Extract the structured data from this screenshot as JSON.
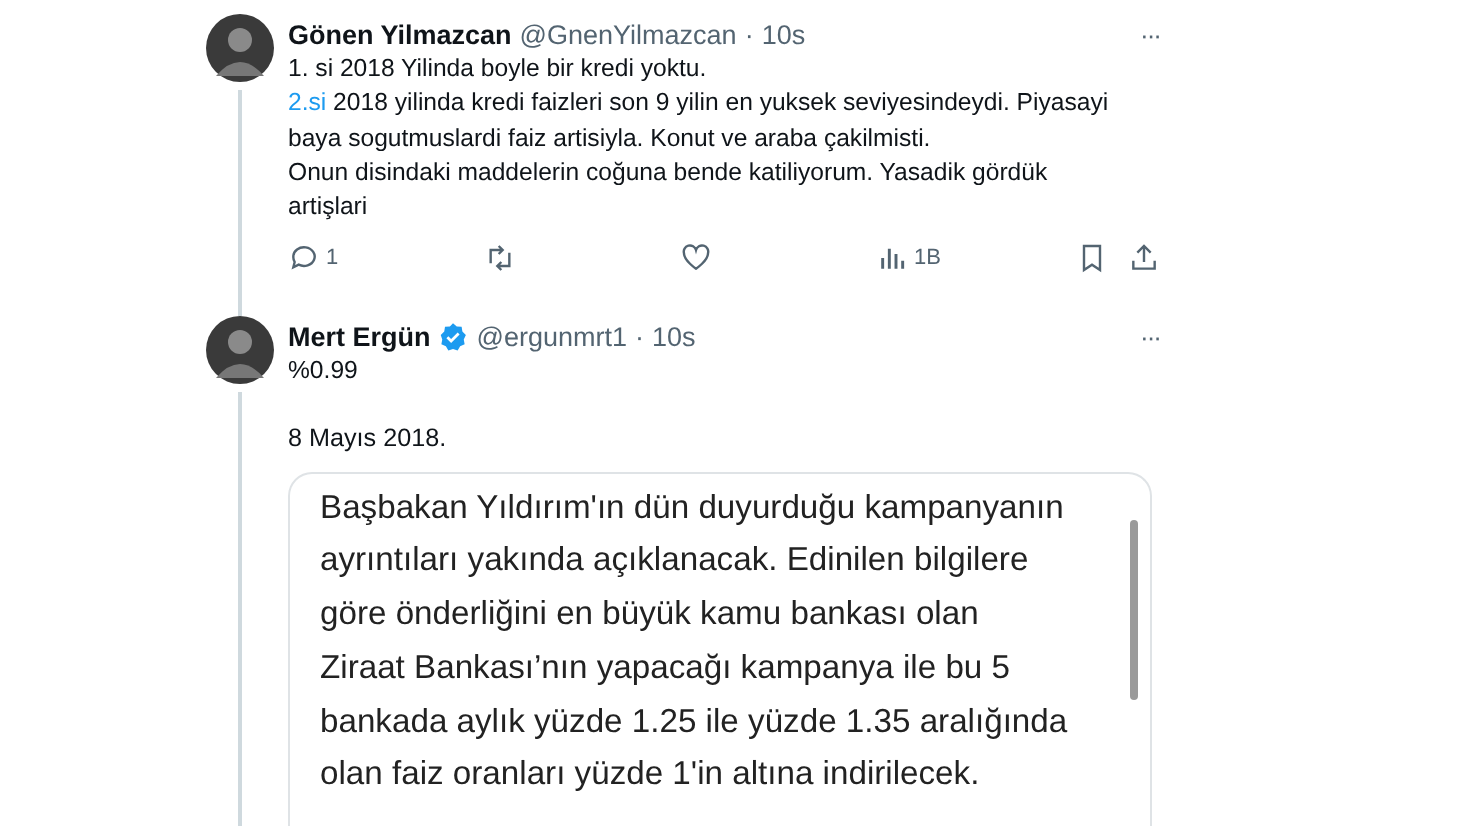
{
  "tweets": [
    {
      "name": "Gönen Yilmazcan",
      "verified": false,
      "handle": "@GnenYilmazcan",
      "separator": "·",
      "time": "10s",
      "more": "···",
      "lines": [
        {
          "parts": [
            {
              "text": "1. si 2018 Yilinda boyle bir kredi yoktu.",
              "link": false
            }
          ]
        },
        {
          "parts": [
            {
              "text": "2.si",
              "link": true
            },
            {
              "text": " 2018 yilinda kredi faizleri son 9 yilin en yuksek seviyesindeydi. Piyasayi baya sogutmuslardi faiz artisiyla. Konut ve araba çakilmisti.",
              "link": false
            }
          ]
        },
        {
          "parts": [
            {
              "text": "Onun disindaki maddelerin coğuna bende katiliyorum. Yasadik gördük artişlari",
              "link": false
            }
          ]
        }
      ],
      "actions": {
        "replies": "1",
        "views": "1B"
      }
    },
    {
      "name": "Mert Ergün",
      "verified": true,
      "handle": "@ergunmrt1",
      "separator": "·",
      "time": "10s",
      "more": "···",
      "lines": [
        {
          "parts": [
            {
              "text": "%0.99",
              "link": false
            }
          ]
        }
      ],
      "date": "8 Mayıs 2018.",
      "embedded_lines": [
        "Başbakan Yıldırım'ın dün duyurduğu kampanyanın",
        "ayrıntıları yakında açıklanacak. Edinilen bilgilere",
        "göre önderliğini en büyük kamu bankası olan",
        "Ziraat Bankası’nın yapacağı kampanya ile bu 5",
        "bankada aylık yüzde 1.25 ile yüzde 1.35 aralığında",
        "olan faiz oranları yüzde 1'in altına indirilecek."
      ]
    }
  ]
}
